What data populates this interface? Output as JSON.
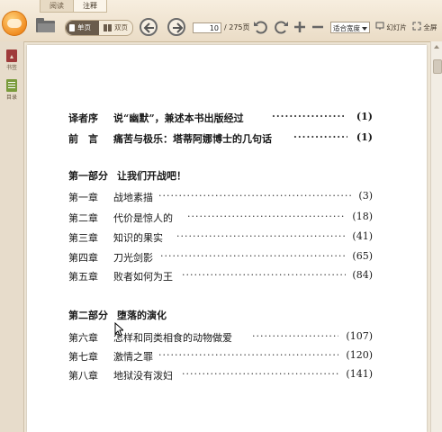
{
  "tabs": [
    "阅读",
    "注释"
  ],
  "toolbar": {
    "single_page": "单页",
    "double_page": "双页",
    "current_page": "10",
    "total_pages": "/ 275页",
    "zoom_mode": "适合宽度",
    "slideshow": "幻灯片",
    "fullscreen": "全屏"
  },
  "sidebar": {
    "items": [
      {
        "label": "书签",
        "icon": "bookmark-icon"
      },
      {
        "label": "目录",
        "icon": "toc-icon"
      }
    ]
  },
  "toc": {
    "front": [
      {
        "label": "译者序",
        "title": "说“幽默”，兼述本书出版经过",
        "page": "(1)"
      },
      {
        "label": "前　言",
        "title": "痛苦与极乐：塔蒂阿娜博士的几句话",
        "page": "(1)"
      }
    ],
    "parts": [
      {
        "label": "第一部分",
        "title": "让我们开战吧！",
        "chapters": [
          {
            "label": "第一章",
            "title": "战地素描",
            "page": "(3)"
          },
          {
            "label": "第二章",
            "title": "代价是惊人的",
            "page": "(18)"
          },
          {
            "label": "第三章",
            "title": "知识的果实",
            "page": "(41)"
          },
          {
            "label": "第四章",
            "title": "刀光剑影",
            "page": "(65)"
          },
          {
            "label": "第五章",
            "title": "败者如何为王",
            "page": "(84)"
          }
        ]
      },
      {
        "label": "第二部分",
        "title": "堕落的演化",
        "chapters": [
          {
            "label": "第六章",
            "title": "怎样和同类相食的动物做爱",
            "page": "(107)"
          },
          {
            "label": "第七章",
            "title": "激情之罪",
            "page": "(120)"
          },
          {
            "label": "第八章",
            "title": "地狱没有泼妇",
            "page": "(141)"
          }
        ]
      }
    ]
  }
}
